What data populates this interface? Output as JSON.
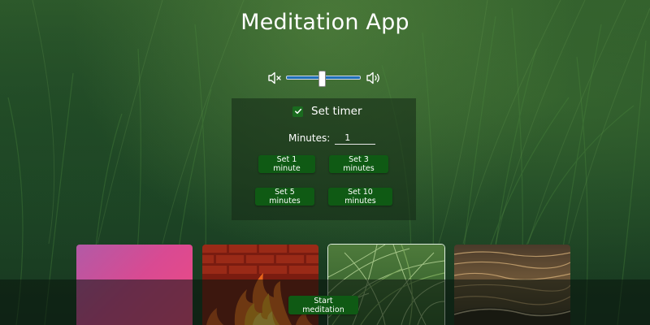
{
  "app": {
    "title": "Meditation App"
  },
  "volume": {
    "mute_icon": "volume-mute-icon",
    "loud_icon": "volume-up-icon",
    "level": 0.48,
    "track_color": "#1f6fb8"
  },
  "timer": {
    "checkbox_checked": true,
    "label": "Set timer",
    "minutes_label": "Minutes:",
    "minutes_value": "1",
    "buttons": [
      {
        "label": "Set 1 minute"
      },
      {
        "label": "Set 3 minutes"
      },
      {
        "label": "Set 5 minutes"
      },
      {
        "label": "Set 10 minutes"
      }
    ]
  },
  "scenes": {
    "items": [
      {
        "name": "pink-gradient",
        "selected": false
      },
      {
        "name": "fire",
        "selected": false
      },
      {
        "name": "grass",
        "selected": true
      },
      {
        "name": "water",
        "selected": false
      }
    ]
  },
  "actions": {
    "start_label": "Start meditation"
  },
  "colors": {
    "button_green": "#0f5a14",
    "checkbox_green": "#1a6b1f",
    "text": "#ffffff"
  }
}
